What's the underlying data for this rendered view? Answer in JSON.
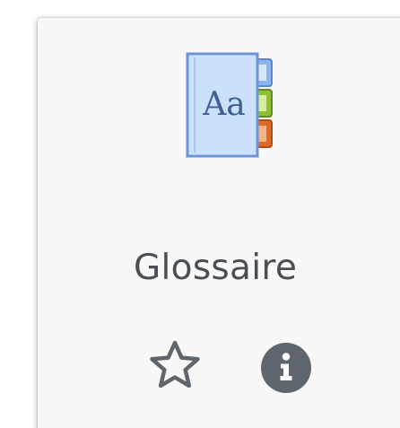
{
  "module": {
    "name": "Glossaire",
    "icon": "glossary-book-icon",
    "icon_text": "Aa"
  },
  "actions": {
    "favourite_icon": "star-outline-icon",
    "info_icon": "info-circle-icon"
  },
  "colors": {
    "card_background": "#f8f8f8",
    "text": "#4a4f55",
    "icon_grey": "#5f656c",
    "book_blue": "#c9def7",
    "book_border": "#6c95d8",
    "tab_blue": "#8bb3ef",
    "tab_green": "#8fbf32",
    "tab_orange": "#de6a2a"
  }
}
